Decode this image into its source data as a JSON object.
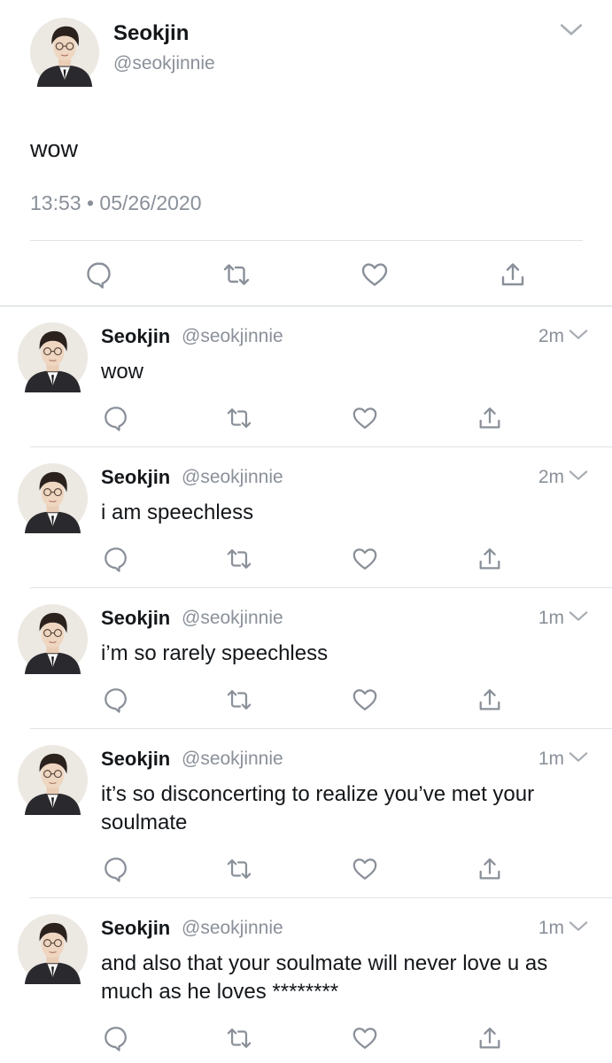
{
  "main_tweet": {
    "name": "Seokjin",
    "handle": "@seokjinnie",
    "text": "wow",
    "time": "13:53",
    "separator": "•",
    "date": "05/26/2020"
  },
  "replies": [
    {
      "name": "Seokjin",
      "handle": "@seokjinnie",
      "time": "2m",
      "text": "wow"
    },
    {
      "name": "Seokjin",
      "handle": "@seokjinnie",
      "time": "2m",
      "text": "i am speechless"
    },
    {
      "name": "Seokjin",
      "handle": "@seokjinnie",
      "time": "1m",
      "text": "i’m so rarely speechless"
    },
    {
      "name": "Seokjin",
      "handle": "@seokjinnie",
      "time": "1m",
      "text": "it’s so disconcerting to realize you’ve met your soulmate"
    },
    {
      "name": "Seokjin",
      "handle": "@seokjinnie",
      "time": "1m",
      "text": "and also that your soulmate will never love u as much as he loves ********"
    }
  ],
  "icons": {
    "reply": "speech-bubble-icon",
    "retweet": "retweet-icon",
    "like": "heart-icon",
    "share": "share-icon",
    "menu": "chevron-down-icon"
  },
  "colors": {
    "text": "#14171a",
    "muted": "#8a9099",
    "icon": "#8a9099",
    "divider": "#dfe3e6"
  }
}
